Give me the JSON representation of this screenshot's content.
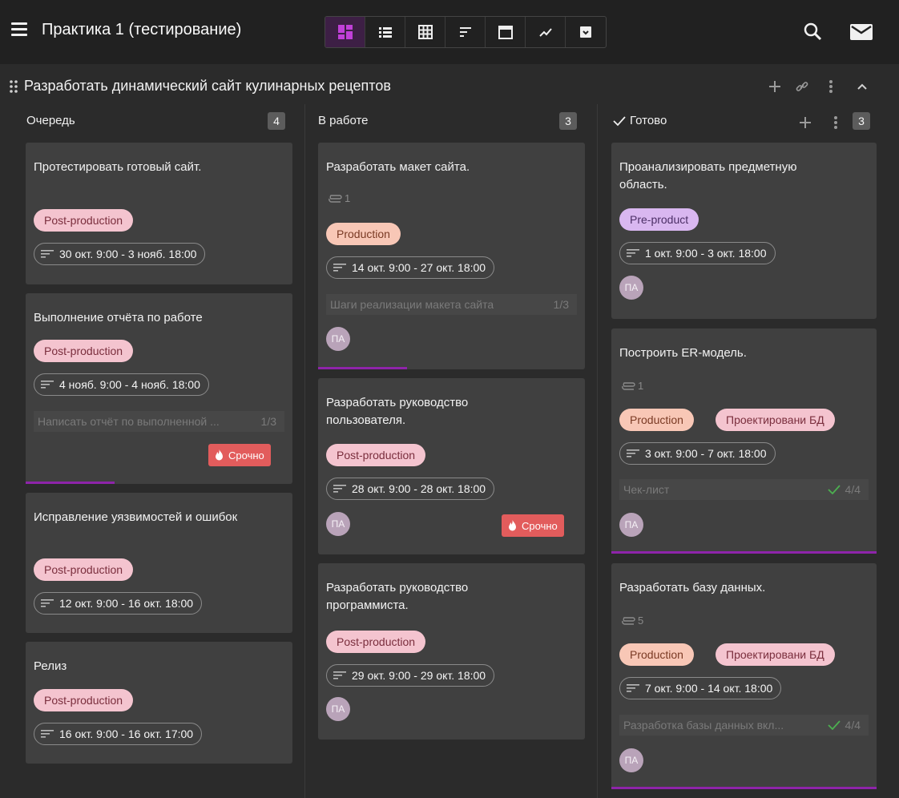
{
  "app": {
    "title": "Практика 1 (тестирование)",
    "views": [
      "board",
      "list",
      "table",
      "gantt",
      "calendar",
      "chart",
      "archive"
    ],
    "active_view": "board",
    "accent_color": "#8e24aa"
  },
  "board": {
    "title": "Разработать динамический сайт кулинарных рецептов",
    "columns": [
      {
        "title": "Очередь",
        "count": "4",
        "cards": [
          {
            "title": "Протестировать готовый сайт.",
            "tags": [
              "Post-production"
            ],
            "date": "30 окт. 9:00 - 3 нояб. 18:00"
          },
          {
            "title": "Выполнение отчёта по работе",
            "tags": [
              "Post-production"
            ],
            "date": "4 нояб. 9:00 - 4 нояб. 18:00",
            "checklist": {
              "label": "Написать отчёт по выполненной ...",
              "count": "1/3"
            },
            "urgent": "Срочно",
            "progress": 0.34
          },
          {
            "title": "Исправление уязвимостей и ошибок",
            "tags": [
              "Post-production"
            ],
            "date": "12 окт. 9:00 - 16 окт. 18:00"
          },
          {
            "title": "Релиз",
            "tags": [
              "Post-production"
            ],
            "date": "16 окт. 9:00 - 16 окт. 17:00"
          }
        ]
      },
      {
        "title": "В работе",
        "count": "3",
        "cards": [
          {
            "title": "Разработать макет сайта.",
            "attachments": "1",
            "tags": [
              "Production"
            ],
            "date": "14 окт. 9:00 - 27 окт. 18:00",
            "checklist": {
              "label": "Шаги реализации макета сайта",
              "count": "1/3"
            },
            "avatar": "ПА",
            "progress": 0.34
          },
          {
            "title": "Разработать руководство пользователя.",
            "tags": [
              "Post-production"
            ],
            "date": "28 окт. 9:00 - 28 окт. 18:00",
            "avatar": "ПА",
            "urgent": "Срочно"
          },
          {
            "title": "Разработать руководство программиста.",
            "tags": [
              "Post-production"
            ],
            "date": "29 окт. 9:00 - 29 окт. 18:00",
            "avatar": "ПА"
          }
        ]
      },
      {
        "title": "Готово",
        "count": "3",
        "cards": [
          {
            "title": "Проанализировать предметную область.",
            "tags": [
              "Pre-product"
            ],
            "date": "1 окт. 9:00 - 3 окт. 18:00",
            "avatar": "ПА"
          },
          {
            "title": "Построить ER-модель.",
            "attachments": "1",
            "tags": [
              "Production",
              "Проектировани БД"
            ],
            "date": "3 окт. 9:00 - 7 окт. 18:00",
            "checklist": {
              "label": "Чек-лист",
              "count": "4/4"
            },
            "avatar": "ПА",
            "progress": 1
          },
          {
            "title": "Разработать базу данных.",
            "attachments": "5",
            "tags": [
              "Production",
              "Проектировани БД"
            ],
            "date": "7 окт. 9:00 - 14 окт. 18:00",
            "checklist": {
              "label": "Разработка базы данных вкл...",
              "count": "4/4"
            },
            "avatar": "ПА",
            "progress": 1
          }
        ]
      }
    ]
  },
  "colors": {
    "post_production": "#f4c4cf",
    "production": "#f8c7b6",
    "pre_product": "#d9b7f0",
    "urgent": "#e25c5c",
    "done_check": "#4caf50"
  }
}
